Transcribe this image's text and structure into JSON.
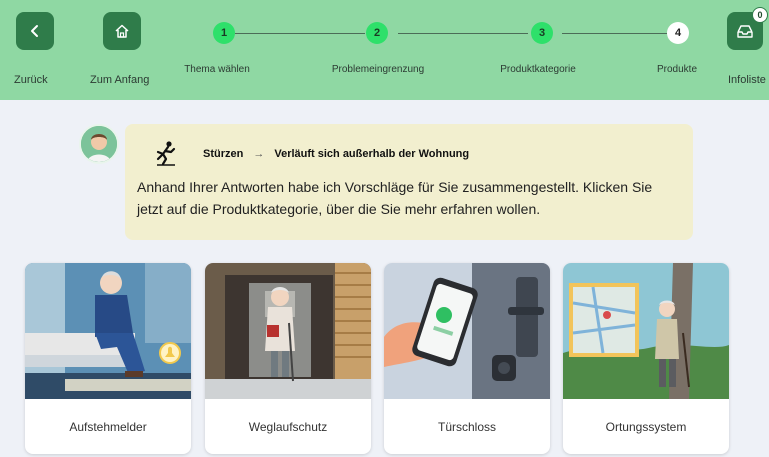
{
  "header": {
    "back_label": "Zurück",
    "home_label": "Zum Anfang",
    "infolist_label": "Infoliste",
    "infolist_count": "0",
    "steps": [
      {
        "number": "1",
        "label": "Thema wählen",
        "state": "done"
      },
      {
        "number": "2",
        "label": "Problemeingrenzung",
        "state": "done"
      },
      {
        "number": "3",
        "label": "Produktkategorie",
        "state": "done"
      },
      {
        "number": "4",
        "label": "Produkte",
        "state": "current"
      }
    ]
  },
  "message": {
    "topic": "Stürzen",
    "arrow": "→",
    "subtopic": "Verläuft sich außerhalb der Wohnung",
    "text": "Anhand Ihrer Antworten habe ich Vorschläge für Sie zusammengestellt. Klicken Sie jetzt auf die Produktkategorie, über die Sie mehr erfahren wollen."
  },
  "cards": [
    {
      "label": "Aufstehmelder",
      "icon": "bed-sensor-illustration"
    },
    {
      "label": "Weglaufschutz",
      "icon": "door-exit-illustration"
    },
    {
      "label": "Türschloss",
      "icon": "smart-lock-illustration"
    },
    {
      "label": "Ortungssystem",
      "icon": "gps-map-illustration"
    }
  ],
  "colors": {
    "header_bg": "#8fd8a3",
    "nav_button": "#2f7c4a",
    "step_done": "#2ee06a",
    "message_bg": "#f2efcf",
    "page_bg": "#eef1f7"
  }
}
